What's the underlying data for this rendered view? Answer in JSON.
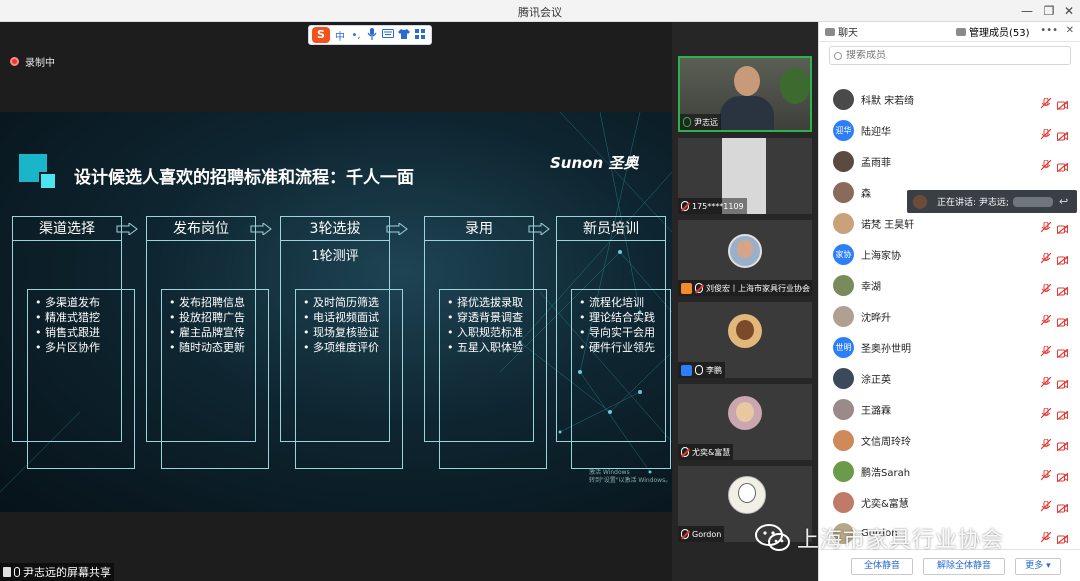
{
  "window": {
    "title": "腾讯会议"
  },
  "ime": {
    "logo": "S",
    "items": [
      "中",
      "•,",
      "🎤",
      "⌨",
      "👕",
      "▦"
    ]
  },
  "recording": {
    "label": "录制中"
  },
  "slide": {
    "title": "设计候选人喜欢的招聘标准和流程：千人一面",
    "brand": "Sunon 圣奥",
    "stages": [
      {
        "head": "渠道选择",
        "sub": "",
        "items": [
          "多渠道发布",
          "精准式猎挖",
          "销售式跟进",
          "多片区协作"
        ]
      },
      {
        "head": "发布岗位",
        "sub": "",
        "items": [
          "发布招聘信息",
          "投放招聘广告",
          "雇主品牌宣传",
          "随时动态更新"
        ]
      },
      {
        "head": "3轮选拔",
        "sub": "1轮测评",
        "items": [
          "及时简历筛选",
          "电话视频面试",
          "现场复核验证",
          "多项维度评价"
        ]
      },
      {
        "head": "录用",
        "sub": "",
        "items": [
          "择优选拔录取",
          "穿透背景调查",
          "入职规范标准",
          "五星入职体验"
        ]
      },
      {
        "head": "新员培训",
        "sub": "",
        "items": [
          "流程化培训",
          "理论结合实践",
          "导向实干会用",
          "硬件行业领先"
        ]
      }
    ],
    "watermark_lines": [
      "激活 Windows",
      "转到\"设置\"以激活 Windows。"
    ]
  },
  "screen_share": {
    "label": "尹志远的屏幕共享"
  },
  "videos": [
    {
      "name": "尹志远",
      "muted": false,
      "badge": ""
    },
    {
      "name": "175****1109",
      "muted": true,
      "badge": ""
    },
    {
      "name": "刘俊宏丨上海市家具行业协会",
      "muted": true,
      "badge": "orange"
    },
    {
      "name": "李鹏",
      "muted": false,
      "badge": "blue"
    },
    {
      "name": "尤奕&富慧",
      "muted": true,
      "badge": ""
    },
    {
      "name": "Gordon",
      "muted": true,
      "badge": ""
    }
  ],
  "panel": {
    "tab_chat": "聊天",
    "tab_members": "管理成员(53)",
    "more_icon": "•••",
    "close_icon": "✕",
    "search_placeholder": "搜索成员",
    "members": [
      {
        "name": "科默 宋若绮",
        "avatar": "",
        "color": "#4a4a4a"
      },
      {
        "name": "陆迎华",
        "avatar": "迎华",
        "color": "#2d7ff9"
      },
      {
        "name": "孟雨菲",
        "avatar": "",
        "color": "#5b4a3f"
      },
      {
        "name": "森",
        "avatar": "",
        "color": "#8a6a5a"
      },
      {
        "name": "诺梵 王昊轩",
        "avatar": "",
        "color": "#c9a27a"
      },
      {
        "name": "上海家协",
        "avatar": "家协",
        "color": "#2d7ff9"
      },
      {
        "name": "幸湖",
        "avatar": "",
        "color": "#7a8a5a"
      },
      {
        "name": "沈晔升",
        "avatar": "",
        "color": "#b0a090"
      },
      {
        "name": "圣奥孙世明",
        "avatar": "世明",
        "color": "#2d7ff9"
      },
      {
        "name": "涂正英",
        "avatar": "",
        "color": "#3a4a5a"
      },
      {
        "name": "王潞霖",
        "avatar": "",
        "color": "#9a8a8a"
      },
      {
        "name": "文信周玲玲",
        "avatar": "",
        "color": "#d08a5a"
      },
      {
        "name": "鹏浩Sarah",
        "avatar": "",
        "color": "#6a9a4a"
      },
      {
        "name": "尤奕&富慧",
        "avatar": "",
        "color": "#c07a6a"
      },
      {
        "name": "Gordon",
        "avatar": "",
        "color": "#b8a888"
      }
    ],
    "btn_mute_all": "全体静音",
    "btn_unmute_all": "解除全体静音",
    "btn_more": "更多 ▾"
  },
  "speaking": {
    "label": "正在讲话: 尹志远;"
  },
  "watermark": {
    "text": "上海市家具行业协会"
  },
  "colors": {
    "accent": "#2d7ff9",
    "active_border": "#2fb24a",
    "record": "#e53935",
    "mute": "#e53935"
  }
}
